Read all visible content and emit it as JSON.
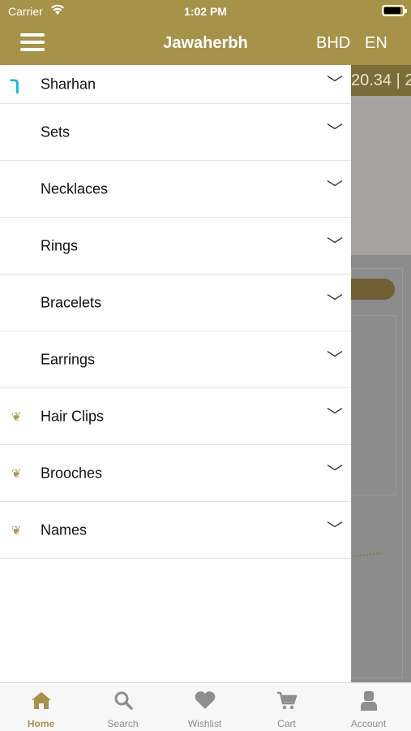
{
  "status_bar": {
    "carrier": "Carrier",
    "time": "1:02 PM"
  },
  "navbar": {
    "title": "Jawaherbh",
    "currency": "BHD",
    "language": "EN"
  },
  "background": {
    "ticker_text": "20.34 | 2"
  },
  "menu": {
    "items": [
      {
        "label": "Sharhan",
        "icon": "sharhan-logo-icon"
      },
      {
        "label": "Sets",
        "icon": ""
      },
      {
        "label": "Necklaces",
        "icon": ""
      },
      {
        "label": "Rings",
        "icon": ""
      },
      {
        "label": "Bracelets",
        "icon": ""
      },
      {
        "label": "Earrings",
        "icon": ""
      },
      {
        "label": "Hair Clips",
        "icon": "brand-logo-icon"
      },
      {
        "label": "Brooches",
        "icon": "brand-logo-icon"
      },
      {
        "label": "Names",
        "icon": "brand-logo-icon"
      }
    ],
    "chevron": "﹀"
  },
  "tabbar": {
    "tabs": [
      {
        "label": "Home",
        "icon": "home-icon",
        "active": true
      },
      {
        "label": "Search",
        "icon": "search-icon",
        "active": false
      },
      {
        "label": "Wishlist",
        "icon": "heart-icon",
        "active": false
      },
      {
        "label": "Cart",
        "icon": "cart-icon",
        "active": false
      },
      {
        "label": "Account",
        "icon": "account-icon",
        "active": false
      }
    ]
  },
  "colors": {
    "brand_gold": "#a7924a",
    "active_tab": "#a7924a",
    "inactive_tab": "#8e8e8e"
  }
}
